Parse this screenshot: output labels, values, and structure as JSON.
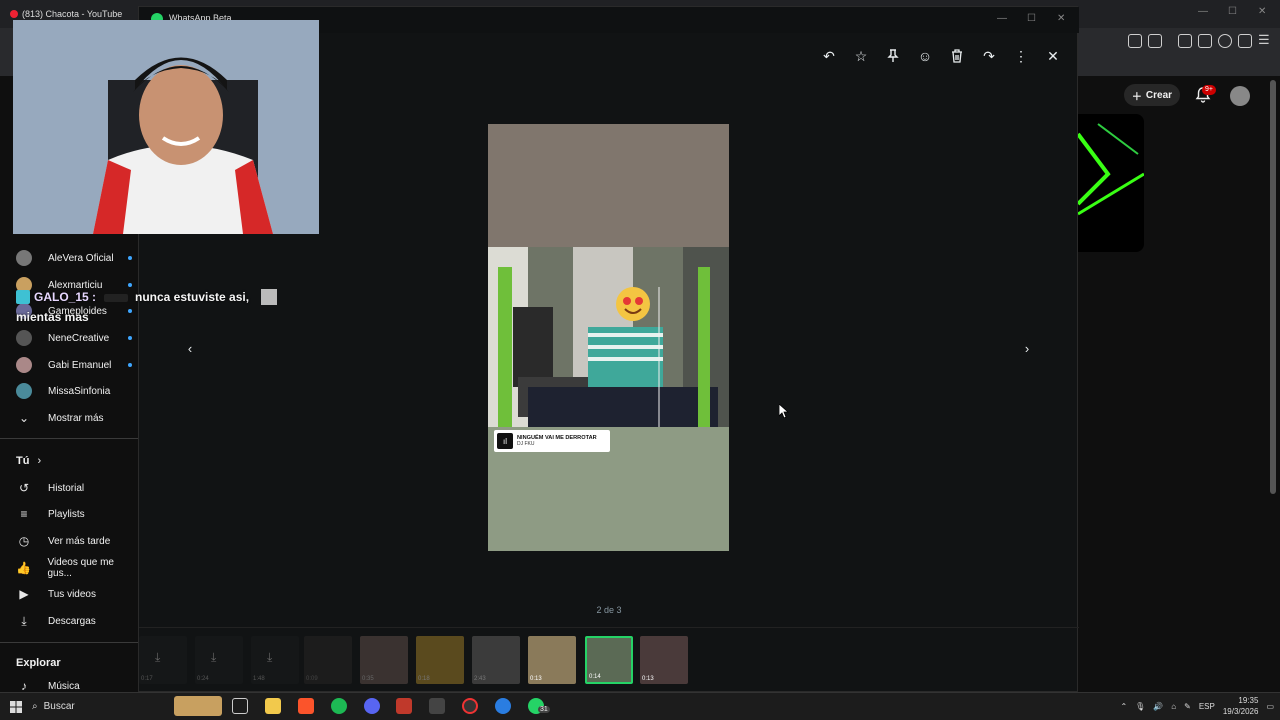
{
  "browser": {
    "tab_title": "(813) Chacota - YouTube"
  },
  "youtube": {
    "create_label": "Crear",
    "notif_count": "9+",
    "subscriptions": [
      {
        "label": "AleVera Oficial"
      },
      {
        "label": "Alexmarticiu"
      },
      {
        "label": "Gameploides"
      },
      {
        "label": "NeneCreative"
      },
      {
        "label": "Gabi Emanuel"
      },
      {
        "label": "MissaSinfonia"
      }
    ],
    "show_more": "Mostrar más",
    "you_section": "Tú",
    "you_items": [
      {
        "label": "Historial"
      },
      {
        "label": "Playlists"
      },
      {
        "label": "Ver más tarde"
      },
      {
        "label": "Videos que me gus..."
      },
      {
        "label": "Tus videos"
      },
      {
        "label": "Descargas"
      }
    ],
    "explore_section": "Explorar",
    "explore_items": [
      {
        "label": "Música"
      }
    ]
  },
  "whatsapp": {
    "window_title": "WhatsApp Beta",
    "toolbar": [
      "reply-icon",
      "star-icon",
      "pin-icon",
      "emoji-icon",
      "delete-icon",
      "forward-icon",
      "more-icon",
      "close-icon"
    ],
    "counter": "2 de 3",
    "sticker": {
      "title": "NINGUÉM VAI ME DERROTAR",
      "artist": "DJ FKU"
    },
    "thumbs": [
      {
        "duration": "0:17"
      },
      {
        "duration": "0:24"
      },
      {
        "duration": "1:48"
      },
      {
        "duration": "0:09"
      },
      {
        "duration": "0:35"
      },
      {
        "duration": "0:18"
      },
      {
        "duration": "2:43"
      },
      {
        "duration": "0:13"
      },
      {
        "duration": "0:14"
      },
      {
        "duration": "0:13"
      }
    ]
  },
  "stream_overlay": {
    "chat_user": "GALO_15 :",
    "chat_message": "nunca estuviste asi,",
    "chat_message_2": "mientas mas"
  },
  "taskbar": {
    "search_label": "Buscar",
    "lang": "ESP",
    "time": "19:35",
    "date": "19/3/2026",
    "whatsapp_badge": "31"
  },
  "colors": {
    "wa_bg": "#111314",
    "yt_bg": "#0f0f0f",
    "selected_thumb_border": "#25d366"
  }
}
